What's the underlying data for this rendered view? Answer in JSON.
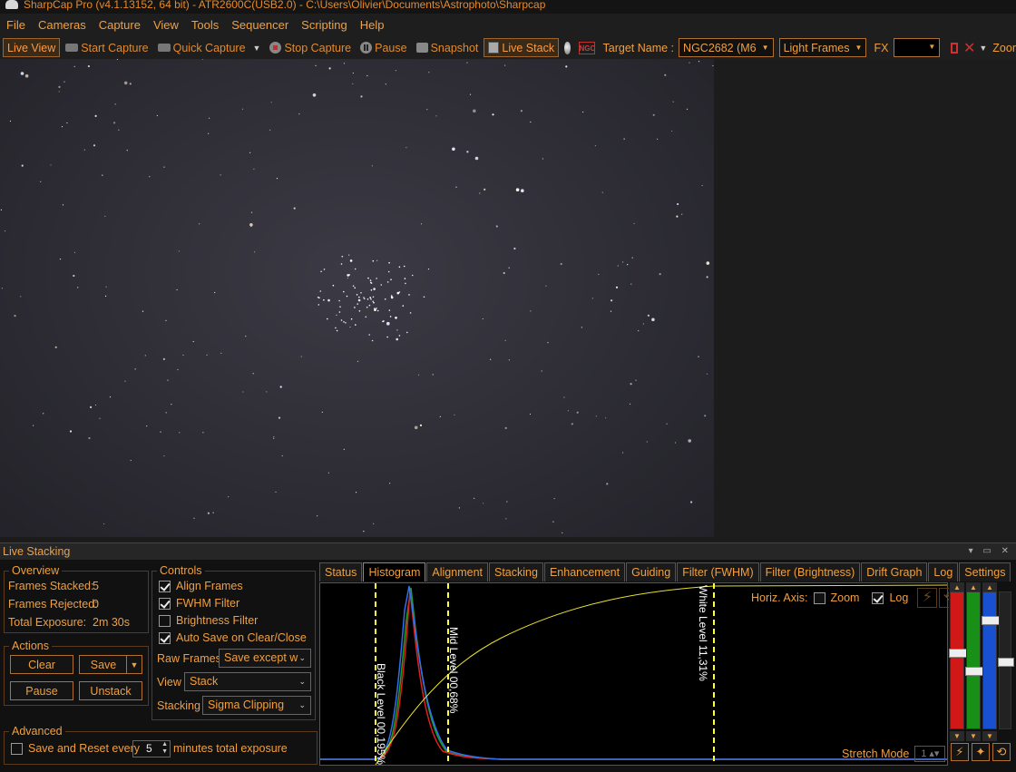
{
  "window": {
    "title": "SharpCap Pro (v4.1.13152, 64 bit) - ATR2600C(USB2.0) - C:\\Users\\Olivier\\Documents\\Astrophoto\\Sharpcap"
  },
  "menu": [
    "File",
    "Cameras",
    "Capture",
    "View",
    "Tools",
    "Sequencer",
    "Scripting",
    "Help"
  ],
  "toolbar": {
    "live_view": "Live View",
    "start_capture": "Start Capture",
    "quick_capture": "Quick Capture",
    "stop_capture": "Stop Capture",
    "pause": "Pause",
    "snapshot": "Snapshot",
    "live_stack": "Live Stack",
    "target_label": "Target Name :",
    "target_value": "NGC2682 (M6",
    "frame_type": "Light Frames",
    "fx_label": "FX",
    "fx_value": "",
    "zoom_label": "Zoor"
  },
  "live_stacking": {
    "title": "Live Stacking",
    "overview": {
      "title": "Overview",
      "frames_stacked_label": "Frames Stacked:",
      "frames_stacked": "5",
      "frames_rejected_label": "Frames Rejected:",
      "frames_rejected": "0",
      "total_exposure_label": "Total Exposure:",
      "total_exposure": "2m 30s"
    },
    "actions": {
      "title": "Actions",
      "clear": "Clear",
      "save": "Save",
      "pause": "Pause",
      "unstack": "Unstack"
    },
    "advanced": {
      "title": "Advanced",
      "save_reset_label": "Save and Reset every",
      "save_reset_checked": false,
      "minutes_value": "5",
      "minutes_suffix": "minutes total exposure"
    },
    "controls": {
      "title": "Controls",
      "align_frames": "Align Frames",
      "align_frames_checked": true,
      "fwhm_filter": "FWHM Filter",
      "fwhm_filter_checked": true,
      "brightness_filter": "Brightness Filter",
      "brightness_filter_checked": false,
      "auto_save": "Auto Save on Clear/Close",
      "auto_save_checked": true,
      "raw_frames_label": "Raw Frames",
      "raw_frames_value": "Save except w",
      "view_label": "View",
      "view_value": "Stack",
      "stacking_label": "Stacking",
      "stacking_value": "Sigma Clipping"
    },
    "tabs": [
      "Status",
      "Histogram",
      "Alignment",
      "Stacking",
      "Enhancement",
      "Guiding",
      "Filter (FWHM)",
      "Filter (Brightness)",
      "Drift Graph",
      "Log",
      "Settings"
    ],
    "active_tab": "Histogram",
    "histogram": {
      "black_level_label": "Black Level  00,195%",
      "mid_level_label": "Mid Level  00,68%",
      "white_level_label": "White Level  11,31%",
      "horiz_axis_label": "Horiz. Axis:",
      "zoom_label": "Zoom",
      "zoom_checked": false,
      "log_label": "Log",
      "log_checked": true,
      "stretch_mode_label": "Stretch Mode",
      "stretch_mode_value": "1"
    },
    "colors": {
      "accent": "#f0a040",
      "red_channel": "#e02020",
      "green_channel": "#20a020",
      "blue_channel": "#2060e0",
      "level_marker": "#ffff40"
    }
  }
}
